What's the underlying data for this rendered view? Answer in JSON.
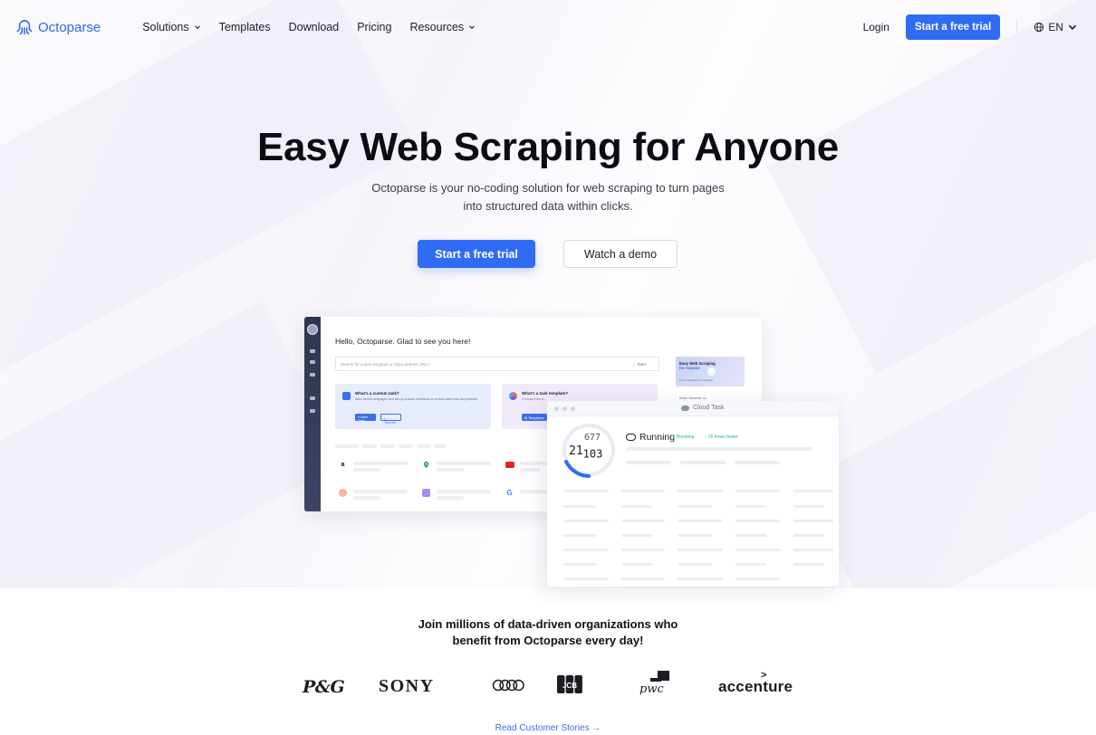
{
  "nav": {
    "logo_text": "Octoparse",
    "menu": [
      {
        "label": "Solutions",
        "dropdown": true
      },
      {
        "label": "Templates",
        "dropdown": false
      },
      {
        "label": "Download",
        "dropdown": false
      },
      {
        "label": "Pricing",
        "dropdown": false
      },
      {
        "label": "Resources",
        "dropdown": true
      }
    ],
    "login": "Login",
    "cta": "Start a free trial",
    "language": "EN"
  },
  "hero": {
    "title": "Easy Web Scraping for Anyone",
    "subtitle_line1": "Octoparse is your no-coding solution for web scraping to turn pages",
    "subtitle_line2": "into structured data within clicks.",
    "primary_cta": "Start a free trial",
    "secondary_cta": "Watch a demo"
  },
  "app_preview": {
    "greeting": "Hello, Octoparse. Glad to see you here!",
    "search_placeholder": "Search for a task template or input website URLs",
    "search_go": "→ Start",
    "card_custom": {
      "title": "What's a custom task?",
      "desc": "Auto-detect webpages and set up custom workflows to extract data from any website.",
      "btn1": "+ New Task",
      "btn2": "▷ Tutorial"
    },
    "card_template": {
      "title": "What's a task template?",
      "desc": "Choose from a...",
      "btn1": "⊞ Templates"
    },
    "promo_title_1": "Easy Web Scraping",
    "promo_title_2": "for Anyone",
    "promo_sub": "Learn Octoparse in minutes",
    "basic_label": "Basic Webinar on"
  },
  "cloud_panel": {
    "title": "Cloud Task",
    "counter_top": "677",
    "counter_main": "21",
    "counter_sub": "103",
    "status": "Running",
    "boosting": "⚡ Boosting",
    "faster": "↑ 20 times faster"
  },
  "social": {
    "headline_line1": "Join millions of data-driven organizations who",
    "headline_line2": "benefit from Octoparse every day!",
    "brands": [
      "P&G",
      "SONY",
      "Audi",
      "JCB",
      "pwc",
      "accenture"
    ],
    "read_link": "Read Customer Stories  →"
  },
  "colors": {
    "accent": "#2f6bf5",
    "link": "#3a6cf0",
    "success": "#2eb86b"
  }
}
